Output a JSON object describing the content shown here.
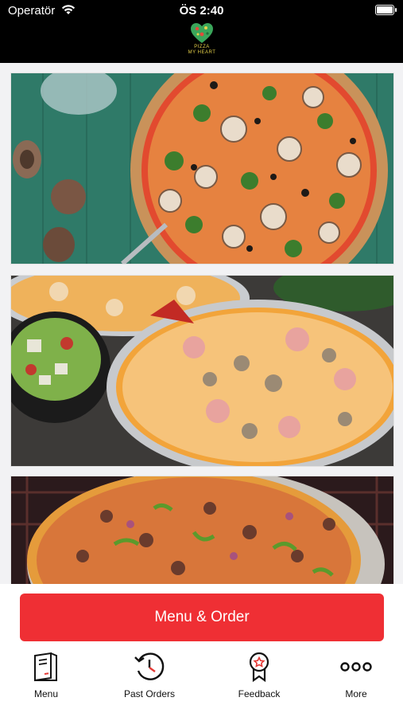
{
  "status_bar": {
    "carrier": "Operatör",
    "time": "ÖS 2:40"
  },
  "header": {
    "logo_line1": "PIZZA",
    "logo_line2": "MY HEART"
  },
  "banners": [
    "pizza-vegetable-image",
    "pizza-family-image",
    "pizza-meat-image"
  ],
  "cta": {
    "label": "Menu & Order",
    "color": "#ef2f34"
  },
  "tabs": [
    {
      "label": "Menu",
      "icon": "menu-book-icon"
    },
    {
      "label": "Past Orders",
      "icon": "history-clock-icon"
    },
    {
      "label": "Feedback",
      "icon": "feedback-badge-icon"
    },
    {
      "label": "More",
      "icon": "more-dots-icon"
    }
  ]
}
